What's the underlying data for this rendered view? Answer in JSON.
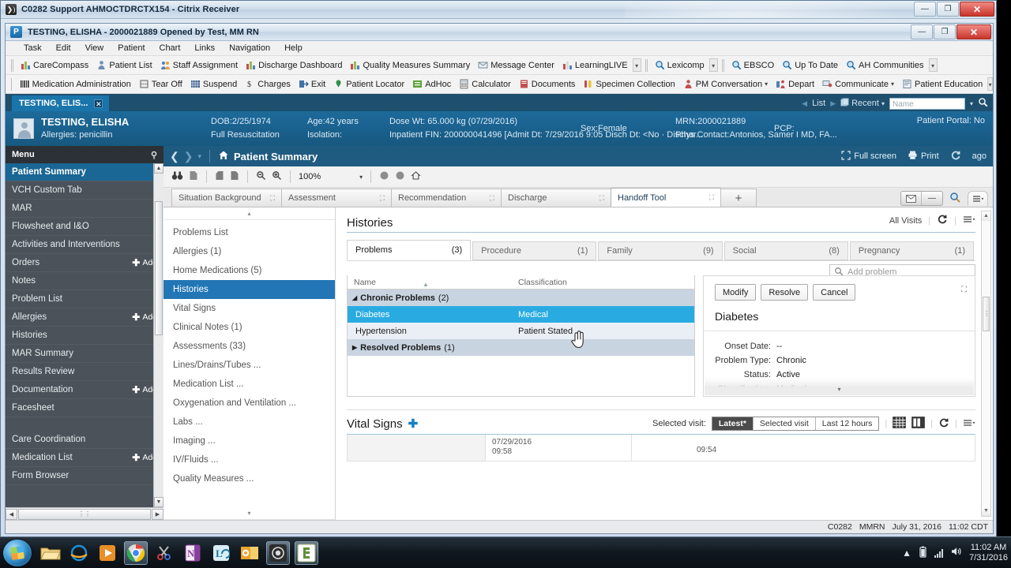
{
  "citrix": {
    "title": "C0282 Support AHMOCTDRCTX154 - Citrix Receiver",
    "icon": "citrix-receiver-icon",
    "minimize": "—",
    "restore": "❐",
    "close": "✕"
  },
  "powerchart": {
    "title": "TESTING, ELISHA - 2000021889 Opened by Test, MM RN",
    "icon_letter": "P",
    "minimize": "—",
    "restore": "❐",
    "close": "✕",
    "menubar": [
      "Task",
      "Edit",
      "View",
      "Patient",
      "Chart",
      "Links",
      "Navigation",
      "Help"
    ],
    "toolbar_row1": [
      {
        "label": "CareCompass",
        "icon": "chart-bars-icon"
      },
      {
        "label": "Patient List",
        "icon": "person-icon"
      },
      {
        "label": "Staff Assignment",
        "icon": "people-icon"
      },
      {
        "label": "Discharge Dashboard",
        "icon": "chart-bars-icon"
      },
      {
        "label": "Quality Measures Summary",
        "icon": "chart-bars-icon"
      },
      {
        "label": "Message Center",
        "icon": "envelope-icon"
      },
      {
        "label": "LearningLIVE",
        "icon": "book-icon"
      }
    ],
    "toolbar_row1b": [
      {
        "label": "Lexicomp",
        "icon": "magnifier-icon"
      }
    ],
    "toolbar_row1c": [
      {
        "label": "EBSCO",
        "icon": "magnifier-icon"
      },
      {
        "label": "Up To Date",
        "icon": "magnifier-icon"
      },
      {
        "label": "AH Communities",
        "icon": "magnifier-icon"
      }
    ],
    "toolbar_row2": [
      {
        "label": "Medication Administration",
        "icon": "barcode-icon"
      },
      {
        "label": "Tear Off",
        "icon": "tearoff-icon"
      },
      {
        "label": "Suspend",
        "icon": "suspend-icon"
      },
      {
        "label": "Charges",
        "icon": "dollar-icon"
      },
      {
        "label": "Exit",
        "icon": "exit-icon"
      },
      {
        "label": "Patient Locator",
        "icon": "pin-icon"
      },
      {
        "label": "AdHoc",
        "icon": "adhoc-icon"
      },
      {
        "label": "Calculator",
        "icon": "calculator-icon"
      },
      {
        "label": "Documents",
        "icon": "document-icon"
      },
      {
        "label": "Specimen Collection",
        "icon": "specimen-icon"
      },
      {
        "label": "PM Conversation",
        "icon": "person-red-icon",
        "dropdown": true
      },
      {
        "label": "Depart",
        "icon": "depart-icon"
      },
      {
        "label": "Communicate",
        "icon": "communicate-icon",
        "dropdown": true
      },
      {
        "label": "Patient Education",
        "icon": "education-icon"
      }
    ]
  },
  "patient_tab": {
    "label": "TESTING, ELIS...",
    "close": "✕",
    "list_label": "List",
    "recent_label": "Recent",
    "recent_caret": "▾",
    "search_placeholder": "Name",
    "search_caret": "▾",
    "search_icon": "magnifier-icon"
  },
  "banner": {
    "name": "TESTING, ELISHA",
    "allergies": "Allergies: penicillin",
    "dob": "DOB:2/25/1974",
    "code_status": "Full Resuscitation",
    "age": "Age:42 years",
    "isolation": "Isolation:",
    "dose_wt": "Dose Wt: 65.000 kg (07/29/2016)",
    "fin": "Inpatient FIN: 200000041496 [Admit Dt: 7/29/2016 9:05 Disch Dt: <No · Dischar...",
    "sex": "Sex:Female",
    "mrn": "MRN:2000021889",
    "pcp": "PCP:",
    "phys_contact": "Phys Contact:Antonios, Samer I MD, FA...",
    "portal": "Patient Portal: No"
  },
  "menu_pane": {
    "header": "Menu",
    "pin_icon": "pin-icon",
    "items": [
      {
        "label": "Patient Summary",
        "selected": true,
        "add": false
      },
      {
        "label": "VCH Custom Tab",
        "selected": false,
        "add": false
      },
      {
        "label": "MAR",
        "selected": false,
        "add": false
      },
      {
        "label": "Flowsheet and I&O",
        "selected": false,
        "add": false
      },
      {
        "label": "Activities and Interventions",
        "selected": false,
        "add": false
      },
      {
        "label": "Orders",
        "selected": false,
        "add": true
      },
      {
        "label": "Notes",
        "selected": false,
        "add": false
      },
      {
        "label": "Problem List",
        "selected": false,
        "add": false
      },
      {
        "label": "Allergies",
        "selected": false,
        "add": true
      },
      {
        "label": "Histories",
        "selected": false,
        "add": false
      },
      {
        "label": "MAR Summary",
        "selected": false,
        "add": false
      },
      {
        "label": "Results Review",
        "selected": false,
        "add": false
      },
      {
        "label": "Documentation",
        "selected": false,
        "add": true
      },
      {
        "label": "Facesheet",
        "selected": false,
        "add": false
      },
      {
        "label": "",
        "selected": false,
        "add": false,
        "spacer": true
      },
      {
        "label": "Care Coordination",
        "selected": false,
        "add": false
      },
      {
        "label": "Medication List",
        "selected": false,
        "add": true
      },
      {
        "label": "Form Browser",
        "selected": false,
        "add": false
      }
    ],
    "add_label": "Add"
  },
  "navbar": {
    "back_icon": "chevron-left-icon",
    "forward_icon": "chevron-right-icon",
    "dropdown_icon": "chevron-down-icon",
    "home_icon": "home-icon",
    "title": "Patient Summary",
    "full_screen": "Full screen",
    "full_screen_icon": "fullscreen-icon",
    "print": "Print",
    "print_icon": "printer-icon",
    "refresh_icon": "refresh-icon",
    "ago": "ago"
  },
  "mini_toolbar": {
    "zoom_value": "100%",
    "icons": [
      "binoculars-icon",
      "page-icon",
      "page-prev-icon",
      "page-next-icon",
      "zoom-out-icon",
      "zoom-in-icon"
    ],
    "right_icons": [
      "circle-icon",
      "circle-icon",
      "home-small-icon"
    ]
  },
  "component_tabs": [
    {
      "label": "Situation Background",
      "active": false,
      "close": "⛶"
    },
    {
      "label": "Assessment",
      "active": false,
      "close": "⛶"
    },
    {
      "label": "Recommendation",
      "active": false,
      "close": "⛶"
    },
    {
      "label": "Discharge",
      "active": false,
      "close": "⛶"
    },
    {
      "label": "Handoff Tool",
      "active": true,
      "close": "⛶"
    }
  ],
  "component_tabs_add": "+",
  "tab_tools": {
    "mail_icon": "envelope-icon",
    "minus_icon": "minus-icon",
    "search_icon": "magnifier-icon",
    "menu_icon": "hamburger-icon"
  },
  "component_list": {
    "up_caret": "▴",
    "down_caret": "▾",
    "items": [
      {
        "label": "Problems List",
        "selected": false
      },
      {
        "label": "Allergies (1)",
        "selected": false
      },
      {
        "label": "Home Medications (5)",
        "selected": false
      },
      {
        "label": "Histories",
        "selected": true
      },
      {
        "label": "Vital Signs",
        "selected": false
      },
      {
        "label": "Clinical Notes (1)",
        "selected": false
      },
      {
        "label": "Assessments (33)",
        "selected": false
      },
      {
        "label": "Lines/Drains/Tubes ...",
        "selected": false
      },
      {
        "label": "Medication List ...",
        "selected": false
      },
      {
        "label": "Oxygenation and Ventilation ...",
        "selected": false
      },
      {
        "label": "Labs ...",
        "selected": false
      },
      {
        "label": "Imaging ...",
        "selected": false
      },
      {
        "label": "IV/Fluids ...",
        "selected": false
      },
      {
        "label": "Quality Measures ...",
        "selected": false
      }
    ]
  },
  "histories": {
    "title": "Histories",
    "all_visits": "All Visits",
    "refresh_icon": "refresh-icon",
    "menu_icon": "hamburger-icon",
    "tabs": [
      {
        "label": "Problems",
        "count": "(3)",
        "active": true
      },
      {
        "label": "Procedure",
        "count": "(1)",
        "active": false
      },
      {
        "label": "Family",
        "count": "(9)",
        "active": false
      },
      {
        "label": "Social",
        "count": "(8)",
        "active": false
      },
      {
        "label": "Pregnancy",
        "count": "(1)",
        "active": false
      }
    ],
    "add_problem_placeholder": "Add problem",
    "add_problem_icon": "magnifier-icon",
    "columns": [
      "Name",
      "Classification"
    ],
    "rows": [
      {
        "type": "group",
        "caret": "◢",
        "name": "Chronic Problems",
        "count": "(2)",
        "classification": ""
      },
      {
        "type": "item",
        "name": "Diabetes",
        "classification": "Medical",
        "selected": true
      },
      {
        "type": "item",
        "name": "Hypertension",
        "classification": "Patient Stated",
        "selected": false
      },
      {
        "type": "group",
        "caret": "▶",
        "name": "Resolved Problems",
        "count": "(1)",
        "classification": ""
      }
    ]
  },
  "detail": {
    "buttons": [
      "Modify",
      "Resolve",
      "Cancel"
    ],
    "close_icon": "expand-icon",
    "title": "Diabetes",
    "fields": [
      {
        "label": "Onset Date:",
        "value": "--"
      },
      {
        "label": "Problem Type:",
        "value": "Chronic"
      },
      {
        "label": "Status:",
        "value": "Active"
      },
      {
        "label": "Classification:",
        "value": "Medical"
      }
    ],
    "more_caret": "▾"
  },
  "vital_signs": {
    "title": "Vital Signs",
    "add_icon": "plus-icon",
    "selected_visit_label": "Selected visit:",
    "segments": [
      {
        "label": "Latest*",
        "on": true
      },
      {
        "label": "Selected visit",
        "on": false
      },
      {
        "label": "Last 12 hours",
        "on": false
      }
    ],
    "view_icons": [
      "grid-view-icon",
      "column-view-icon"
    ],
    "refresh_icon": "refresh-icon",
    "menu_icon": "hamburger-icon",
    "col1_date": "07/29/2016",
    "col1_time": "09:58",
    "col2_time": "09:54"
  },
  "statusbar": {
    "items": [
      "C0282",
      "MMRN",
      "July 31, 2016",
      "11:02 CDT"
    ]
  },
  "taskbar": {
    "start_icon": "windows-start-icon",
    "items": [
      {
        "name": "explorer-icon",
        "active": false
      },
      {
        "name": "internet-explorer-icon",
        "active": false
      },
      {
        "name": "media-player-icon",
        "active": false
      },
      {
        "name": "chrome-icon",
        "active": true
      },
      {
        "name": "snipping-tool-icon",
        "active": false
      },
      {
        "name": "onenote-icon",
        "active": false
      },
      {
        "name": "lync-icon",
        "active": false
      },
      {
        "name": "outlook-icon",
        "active": false
      },
      {
        "name": "citrix-receiver-icon",
        "active": true
      },
      {
        "name": "powerchart-icon",
        "active": true
      }
    ],
    "tray": {
      "show_hidden_icon": "▲",
      "battery_icon": "battery-icon",
      "network_icon": "signal-icon",
      "volume_icon": "speaker-icon",
      "time": "11:02 AM",
      "date": "7/31/2016"
    }
  }
}
